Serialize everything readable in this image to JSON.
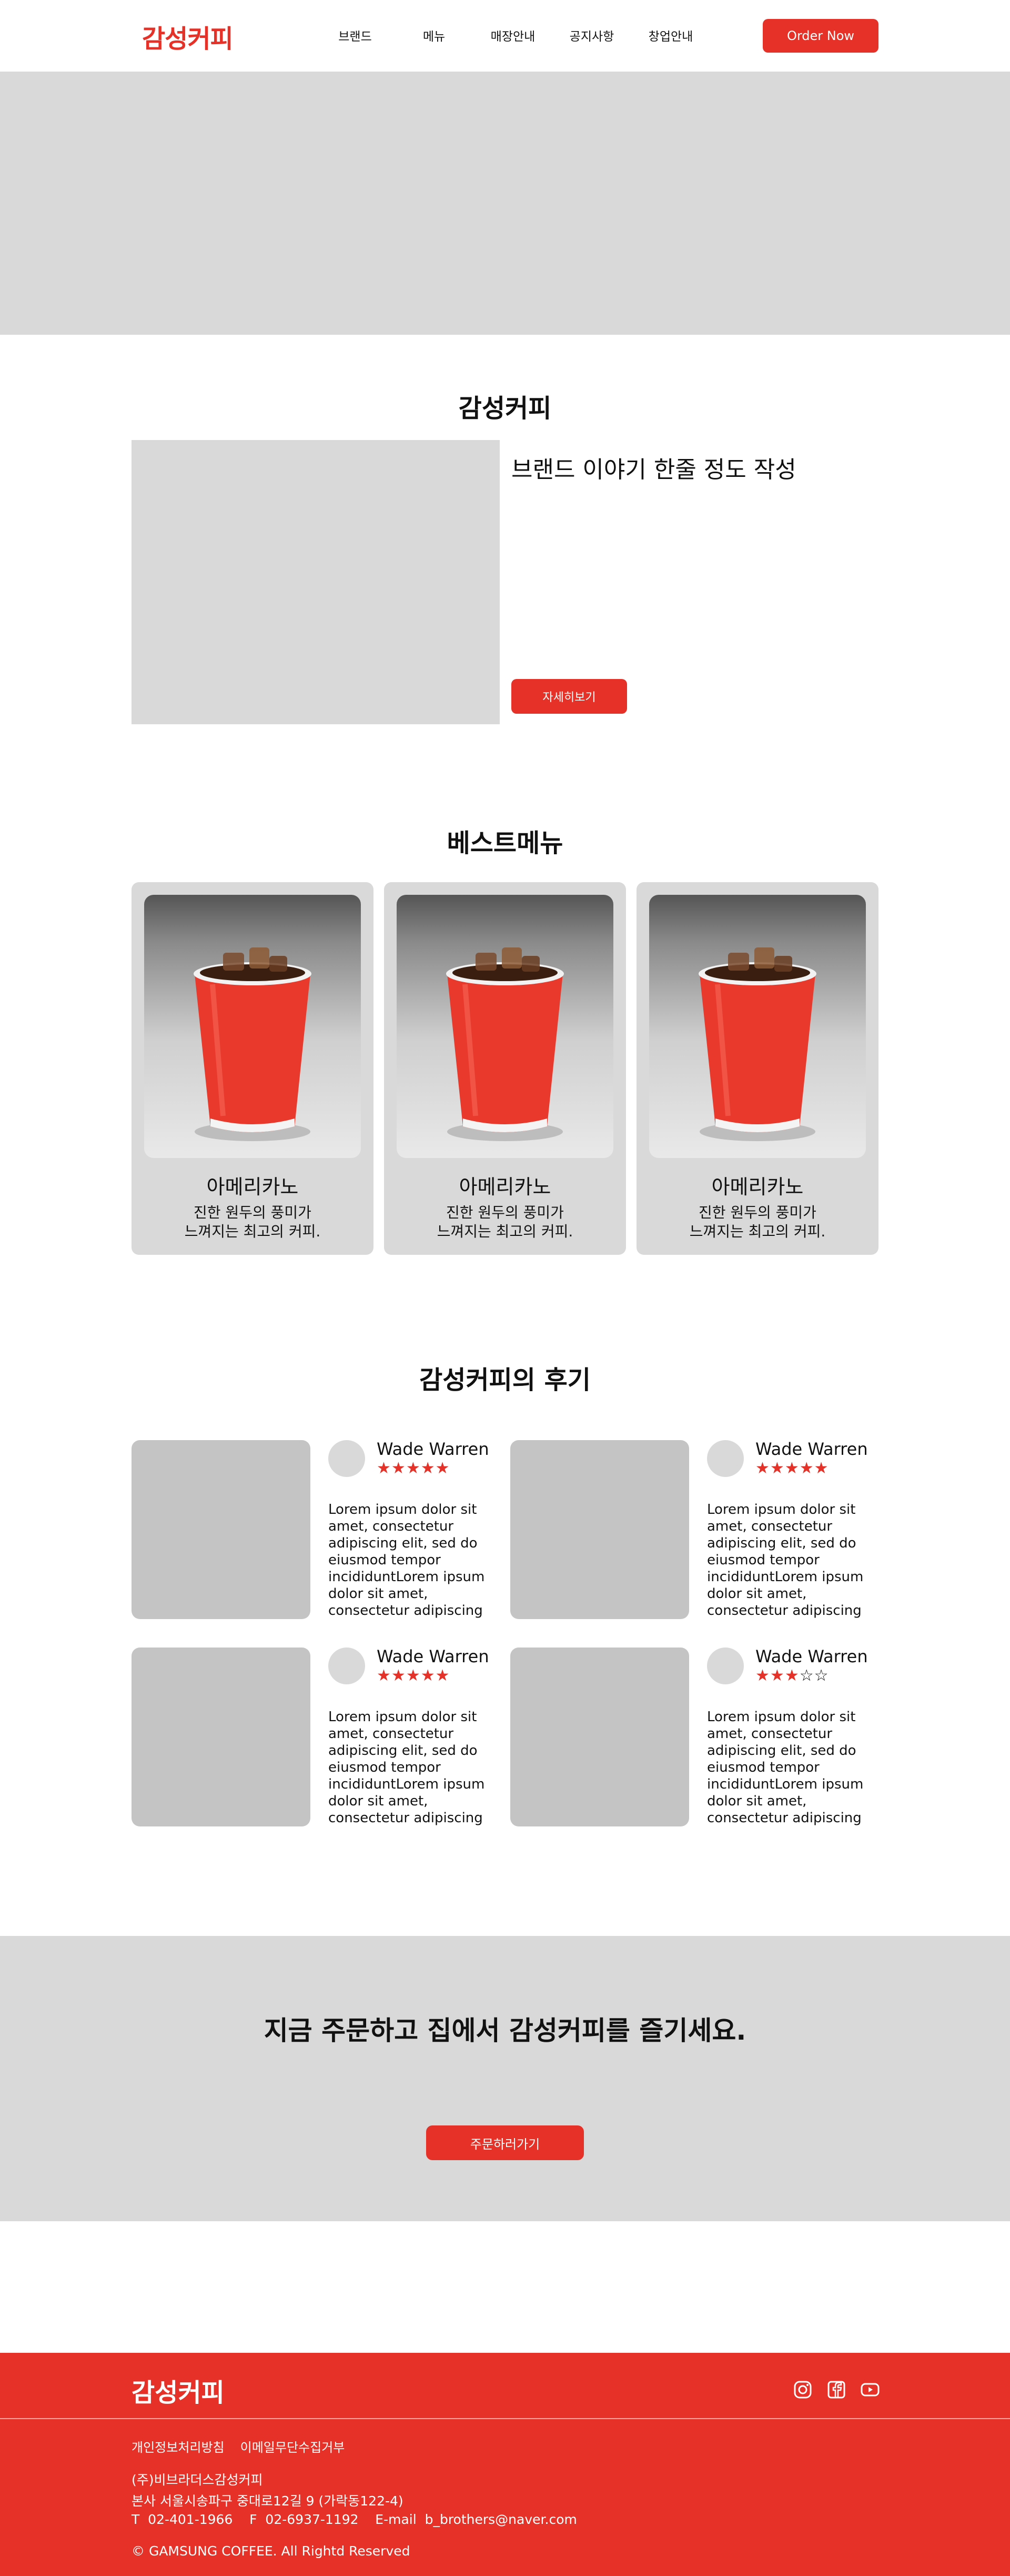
{
  "header": {
    "logo": "감성커피",
    "nav": [
      "브랜드",
      "메뉴",
      "매장안내",
      "공지사항",
      "창업안내"
    ],
    "order_now": "Order Now"
  },
  "brand": {
    "title": "감성커피",
    "story": "브랜드 이야기 한줄 정도 작성",
    "more": "자세히보기"
  },
  "best_menu": {
    "title": "베스트메뉴",
    "items": [
      {
        "name": "아메리카노",
        "desc_line1": "진한 원두의 풍미가",
        "desc_line2": "느껴지는 최고의 커피."
      },
      {
        "name": "아메리카노",
        "desc_line1": "진한 원두의 풍미가",
        "desc_line2": "느껴지는 최고의 커피."
      },
      {
        "name": "아메리카노",
        "desc_line1": "진한 원두의 풍미가",
        "desc_line2": "느껴지는 최고의 커피."
      }
    ]
  },
  "reviews": {
    "title": "감성커피의 후기",
    "items": [
      {
        "name": "Wade Warren",
        "rating": 5,
        "text": "Lorem ipsum dolor sit amet, consectetur adipiscing elit, sed do eiusmod tempor incididuntLorem ipsum dolor sit amet, consectetur adipiscing"
      },
      {
        "name": "Wade Warren",
        "rating": 5,
        "text": "Lorem ipsum dolor sit amet, consectetur adipiscing elit, sed do eiusmod tempor incididuntLorem ipsum dolor sit amet, consectetur adipiscing"
      },
      {
        "name": "Wade Warren",
        "rating": 5,
        "text": "Lorem ipsum dolor sit amet, consectetur adipiscing elit, sed do eiusmod tempor incididuntLorem ipsum dolor sit amet, consectetur adipiscing"
      },
      {
        "name": "Wade Warren",
        "rating": 3,
        "max_rating": 5,
        "text": "Lorem ipsum dolor sit amet, consectetur adipiscing elit, sed do eiusmod tempor incididuntLorem ipsum dolor sit amet, consectetur adipiscing"
      }
    ]
  },
  "cta": {
    "title": "지금 주문하고 집에서 감성커피를 즐기세요.",
    "button": "주문하러가기"
  },
  "footer": {
    "logo": "감성커피",
    "icons": [
      "instagram-icon",
      "facebook-icon",
      "youtube-icon"
    ],
    "links": [
      "개인정보처리방침",
      "이메일무단수집거부"
    ],
    "company": "(주)비브라더스감성커피",
    "address": "본사  서울시송파구 중대로12길 9 (가락동122-4)",
    "contact": "T  02-401-1966    F  02-6937-1192    E-mail  b_brothers@naver.com",
    "copyright": "© GAMSUNG COFFEE. All Rightd Reserved"
  },
  "colors": {
    "accent": "#e53127",
    "placeholder": "#d9d9d9",
    "review_placeholder": "#c4c4c4"
  }
}
